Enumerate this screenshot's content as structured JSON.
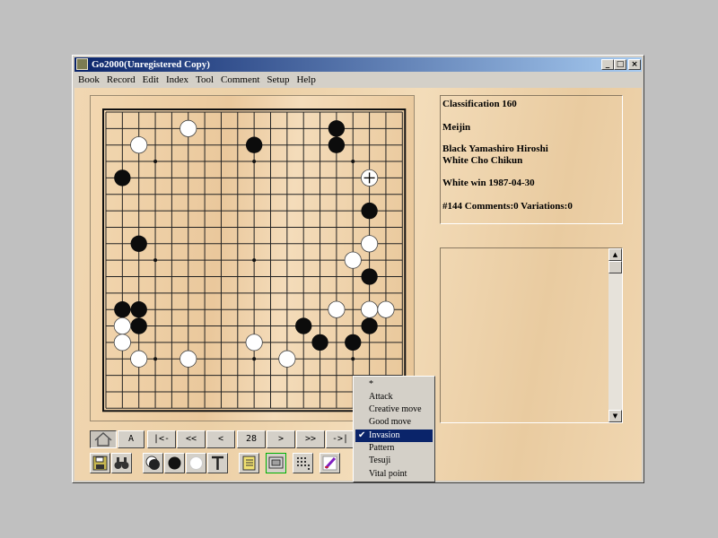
{
  "window": {
    "title": "Go2000(Unregistered Copy)",
    "controls": [
      "_",
      "□",
      "×"
    ]
  },
  "menu": [
    "Book",
    "Record",
    "Edit",
    "Index",
    "Tool",
    "Comment",
    "Setup",
    "Help"
  ],
  "game_info": {
    "classification": "Classification  160",
    "tournament": "Meijin",
    "black": "Black  Yamashiro Hiroshi",
    "white": "White  Cho Chikun",
    "result": "White win  1987-04-30",
    "status": "#144 Comments:0 Variations:0"
  },
  "board": {
    "size": 19,
    "black_stones": [
      [
        14,
        1
      ],
      [
        9,
        2
      ],
      [
        14,
        2
      ],
      [
        1,
        4
      ],
      [
        16,
        6
      ],
      [
        2,
        8
      ],
      [
        16,
        10
      ],
      [
        1,
        12
      ],
      [
        2,
        12
      ],
      [
        2,
        13
      ],
      [
        12,
        13
      ],
      [
        16,
        13
      ],
      [
        13,
        14
      ],
      [
        15,
        14
      ]
    ],
    "white_stones": [
      [
        5,
        1
      ],
      [
        2,
        2
      ],
      [
        16,
        4
      ],
      [
        16,
        8
      ],
      [
        15,
        9
      ],
      [
        14,
        12
      ],
      [
        16,
        12
      ],
      [
        17,
        12
      ],
      [
        1,
        13
      ],
      [
        1,
        14
      ],
      [
        9,
        14
      ],
      [
        2,
        15
      ],
      [
        5,
        15
      ],
      [
        11,
        15
      ]
    ],
    "last_move": [
      16,
      4
    ],
    "hoshi": [
      [
        3,
        3
      ],
      [
        9,
        3
      ],
      [
        15,
        3
      ],
      [
        3,
        9
      ],
      [
        9,
        9
      ],
      [
        15,
        9
      ],
      [
        3,
        15
      ],
      [
        9,
        15
      ],
      [
        15,
        15
      ]
    ]
  },
  "nav": {
    "buttons": [
      "",
      "A",
      "|<-",
      "<<",
      "<",
      "28",
      ">",
      ">>",
      "->|"
    ]
  },
  "popup_menu": {
    "items": [
      "*",
      "Attack",
      "Creative move",
      "Good move",
      "Invasion",
      "Pattern",
      "Tesuji",
      "Vital point"
    ],
    "selected_index": 4,
    "check_mark": "✔"
  }
}
